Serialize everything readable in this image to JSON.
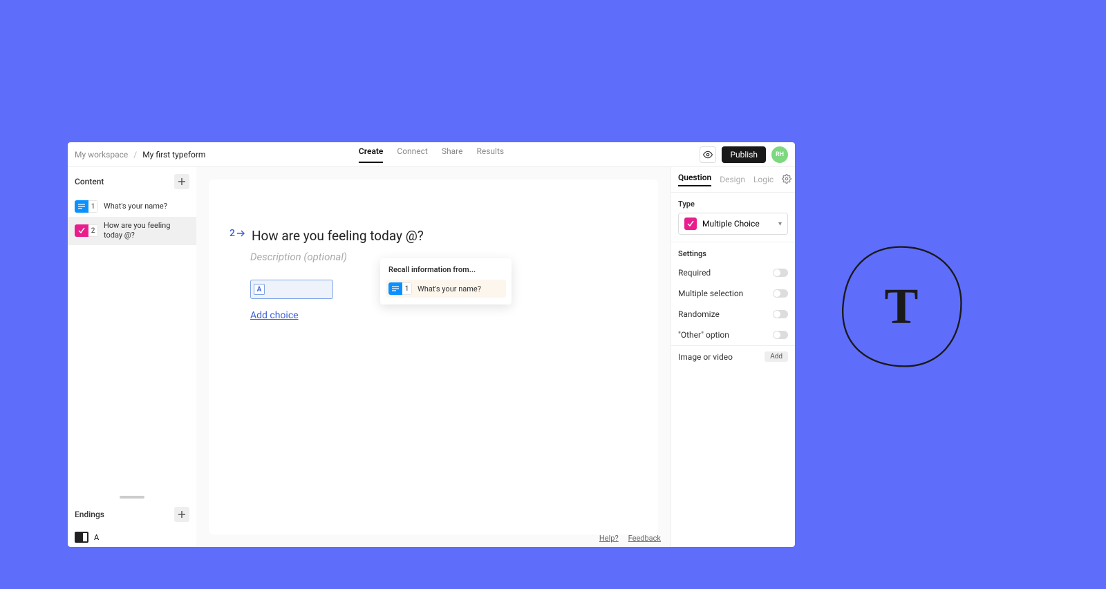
{
  "breadcrumb": {
    "workspace": "My workspace",
    "current": "My first typeform"
  },
  "topTabs": {
    "create": "Create",
    "connect": "Connect",
    "share": "Share",
    "results": "Results"
  },
  "topRight": {
    "publish": "Publish",
    "avatar": "RH"
  },
  "sidebar": {
    "contentHeader": "Content",
    "questions": [
      {
        "num": "1",
        "text": "What's your name?",
        "color": "blue"
      },
      {
        "num": "2",
        "text": "How are you feeling today @?",
        "color": "pink"
      }
    ],
    "endingsHeader": "Endings",
    "endingLabel": "A"
  },
  "canvas": {
    "qNumber": "2",
    "qTitle": "How are you feeling today @?",
    "qDesc": "Description (optional)",
    "choiceLetter": "A",
    "addChoice": "Add choice",
    "recallTitle": "Recall information from...",
    "recallItemNum": "1",
    "recallItemText": "What's your name?"
  },
  "footer": {
    "help": "Help?",
    "feedback": "Feedback"
  },
  "rightPanel": {
    "tabs": {
      "question": "Question",
      "design": "Design",
      "logic": "Logic"
    },
    "typeLabel": "Type",
    "typeValue": "Multiple Choice",
    "settingsLabel": "Settings",
    "settings": {
      "required": "Required",
      "multiple": "Multiple selection",
      "randomize": "Randomize",
      "other": "\"Other\" option"
    },
    "mediaLabel": "Image or video",
    "addBtn": "Add"
  },
  "logo": "T"
}
